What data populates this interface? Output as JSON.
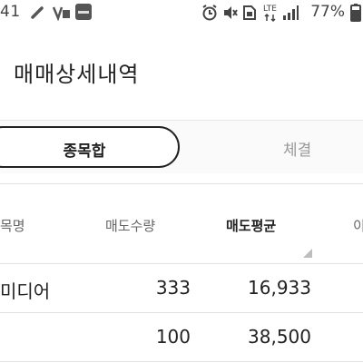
{
  "status_bar": {
    "time": "41",
    "battery": "77%",
    "network": "LTE",
    "icons": [
      "phone-link-icon",
      "nfc-pay-icon",
      "app-notification-icon",
      "alarm-icon",
      "mute-icon",
      "sim-icon",
      "lte-icon",
      "signal-icon",
      "battery-icon"
    ]
  },
  "header": {
    "title": "매매상세내역"
  },
  "toggle": {
    "active_label": "종목합",
    "inactive_label": "체결"
  },
  "table": {
    "columns": [
      "목명",
      "매도수량",
      "매도평균",
      "이"
    ],
    "sorted_column": "매도평균",
    "rows": [
      {
        "name": "미디어",
        "qty": "333",
        "avg": "16,933"
      },
      {
        "name": "",
        "qty": "100",
        "avg": "38,500"
      }
    ]
  },
  "colors": {
    "text": "#222222",
    "muted": "#999999",
    "divider": "#e2e2e2"
  }
}
